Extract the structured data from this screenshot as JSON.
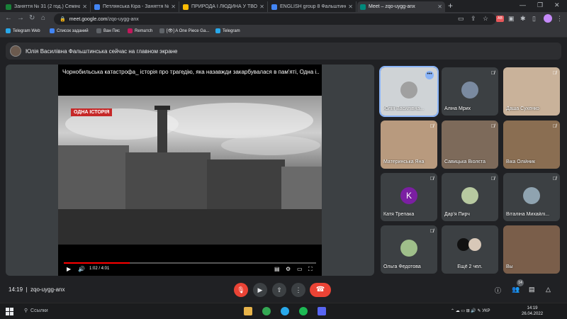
{
  "browser": {
    "tabs": [
      {
        "title": "Заняття № 31 (2 год.) Семінарсь...",
        "color": "#188038",
        "active": false
      },
      {
        "title": "Петлянська Кіра - Заняття № 31 (...",
        "color": "#4285f4",
        "active": false
      },
      {
        "title": "ПРИРОДА І ЛЮДИНА У ТВОРЧОС...",
        "color": "#fbbc04",
        "active": false
      },
      {
        "title": "ENGLISH group 8 Фальштинська...",
        "color": "#4285f4",
        "active": false
      },
      {
        "title": "Meet – zqo-uygg-anx",
        "color": "#00897b",
        "active": true
      }
    ],
    "new_tab": "+",
    "url_host": "meet.google.com",
    "url_path": "/zqo-uygg-anx",
    "bookmarks": [
      {
        "label": "Telegram Web",
        "color": "#29a9eb"
      },
      {
        "label": "Список заданий",
        "color": "#4285f4"
      },
      {
        "label": "Ван Пис",
        "color": "#5f6368"
      },
      {
        "label": "Remaтch",
        "color": "#c2185b"
      },
      {
        "label": "[👁] A One Piece Ga...",
        "color": "#5f6368"
      },
      {
        "label": "Telegram",
        "color": "#29a9eb"
      }
    ]
  },
  "meet": {
    "banner": "Юлія Василівна Фальштинська сейчас на главном экране",
    "video": {
      "title": "Чорнобильська катастрофа_ історія про трагедію, яка назавжди закарбувалася в пам'яті, Одна і...",
      "badge": "ОДНА ІСТОРІЯ",
      "time": "1:02 / 4:01",
      "progress": 0.26
    },
    "participants": [
      {
        "name": "Юлія Василівна...",
        "muted": false,
        "presenting": true
      },
      {
        "name": "Аліна Мрих",
        "muted": true
      },
      {
        "name": "Даша Сухенко",
        "muted": true
      },
      {
        "name": "Материнська Яна",
        "muted": true
      },
      {
        "name": "Савицька Віолєта",
        "muted": true
      },
      {
        "name": "Віка Олійник",
        "muted": true
      },
      {
        "name": "Катя Трепака",
        "muted": true,
        "initial": "K"
      },
      {
        "name": "Дар'я Пирч",
        "muted": true
      },
      {
        "name": "Віталіна Михайлі...",
        "muted": true
      },
      {
        "name": "Ольга Федотова",
        "muted": true
      },
      {
        "name": "Ещё 2 чел.",
        "muted": false
      },
      {
        "name": "Вы",
        "muted": false
      }
    ],
    "meeting_time": "14:19",
    "meeting_code": "zqo-uygg-anx",
    "participant_count": "14"
  },
  "taskbar": {
    "search": "Ссылки",
    "lang": "УКР",
    "time": "14:19",
    "date": "26.04.2022"
  }
}
